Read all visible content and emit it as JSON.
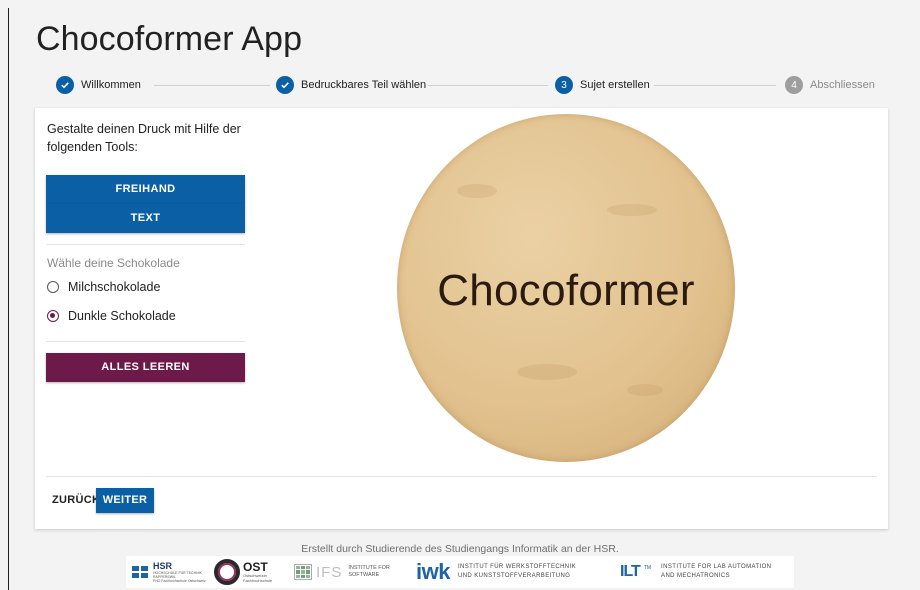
{
  "app": {
    "title": "Chocoformer App"
  },
  "stepper": {
    "steps": [
      {
        "label": "Willkommen",
        "marker": "check-icon",
        "state": "done"
      },
      {
        "label": "Bedruckbares Teil wählen",
        "marker": "check-icon",
        "state": "done"
      },
      {
        "label": "Sujet erstellen",
        "number": "3",
        "state": "active"
      },
      {
        "label": "Abschliessen",
        "number": "4",
        "state": "todo"
      }
    ],
    "colors": {
      "done": "#0b5fa5",
      "active": "#0b5fa5",
      "todo": "#9e9e9e"
    }
  },
  "tools": {
    "intro": "Gestalte deinen Druck mit Hilfe der folgenden Tools:",
    "freehand_label": "FREIHAND",
    "text_label": "TEXT"
  },
  "chocolate": {
    "label": "Wähle deine Schokolade",
    "options": [
      {
        "label": "Milchschokolade",
        "selected": false
      },
      {
        "label": "Dunkle Schokolade",
        "selected": true
      }
    ]
  },
  "clear_label": "ALLES LEEREN",
  "preview": {
    "text": "Chocoformer"
  },
  "nav": {
    "back_label": "ZURÜCK",
    "next_label": "WEITER"
  },
  "footer": {
    "credit": "Erstellt durch Studierende des Studiengangs Informatik an der HSR.",
    "logos": {
      "hsr": {
        "name": "HSR",
        "sub1": "HOCHSCHULE FÜR TECHNIK",
        "sub2": "RAPPERSWIL",
        "sub3": "FHO Fachhochschule Ostschweiz"
      },
      "ost": {
        "name": "OST",
        "sub1": "Ostschweizer",
        "sub2": "Fachhochschule"
      },
      "ifs": {
        "name": "IFS",
        "sub1": "INSTITUTE FOR",
        "sub2": "SOFTWARE"
      },
      "iwk": {
        "name": "iwk",
        "sub1": "INSTITUT FÜR WERKSTOFFTECHNIK",
        "sub2": "UND KUNSTSTOFFVERARBEITUNG"
      },
      "ila": {
        "name": "ILT",
        "tm": "TM",
        "sub1": "INSTITUTE FOR LAB AUTOMATION",
        "sub2": "AND MECHATRONICS"
      }
    }
  },
  "colors": {
    "primary": "#0b5fa5",
    "danger": "#6d1a4b",
    "radio_checked": "#6d1a4b"
  }
}
